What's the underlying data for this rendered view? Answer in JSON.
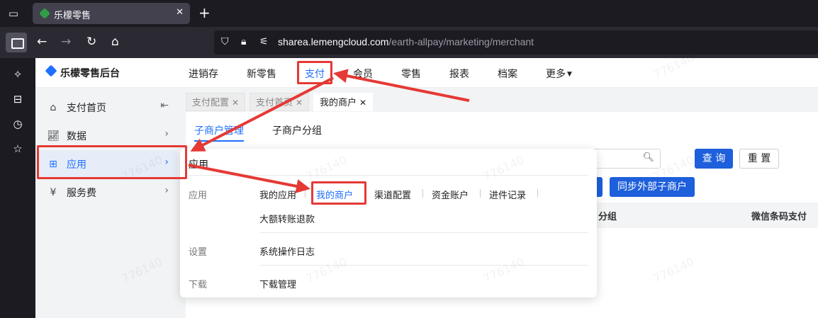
{
  "browser": {
    "tab_title": "乐檬零售",
    "tab_close": "✕",
    "new_tab": "+",
    "url_host": "sharea.lemengcloud.com",
    "url_path": "/earth-allpay/marketing/merchant"
  },
  "app": {
    "brand": "乐檬零售后台",
    "topnav": [
      "进销存",
      "新零售",
      "支付",
      "会员",
      "零售",
      "报表",
      "档案",
      "更多"
    ],
    "active_topnav": "支付"
  },
  "sidebar": {
    "items": [
      {
        "label": "支付首页",
        "icon": "home-icon"
      },
      {
        "label": "数据",
        "icon": "chart-icon"
      },
      {
        "label": "应用",
        "icon": "apps-grid-icon"
      },
      {
        "label": "服务费",
        "icon": "yen-icon"
      }
    ],
    "active": "应用"
  },
  "page_tabs": [
    {
      "label": "支付配置"
    },
    {
      "label": "支付首页"
    },
    {
      "label": "我的商户"
    }
  ],
  "subtabs": [
    "子商户管理",
    "子商户分组"
  ],
  "buttons": {
    "query": "查 询",
    "reset": "重 置",
    "sync": "同步外部子商户"
  },
  "table_headers": [
    "分组",
    "微信条码支付"
  ],
  "dropdown": {
    "title": "应用",
    "sections": [
      {
        "category": "应用",
        "links": [
          "我的应用",
          "我的商户",
          "渠道配置",
          "资金账户",
          "进件记录",
          "大额转账退款"
        ]
      },
      {
        "category": "设置",
        "links": [
          "系统操作日志"
        ]
      },
      {
        "category": "下载",
        "links": [
          "下载管理"
        ]
      }
    ]
  },
  "watermark": "776140",
  "colors": {
    "accent": "#1e6fff",
    "annotation_red": "#e53935",
    "primary_button": "#1e5fdb"
  }
}
